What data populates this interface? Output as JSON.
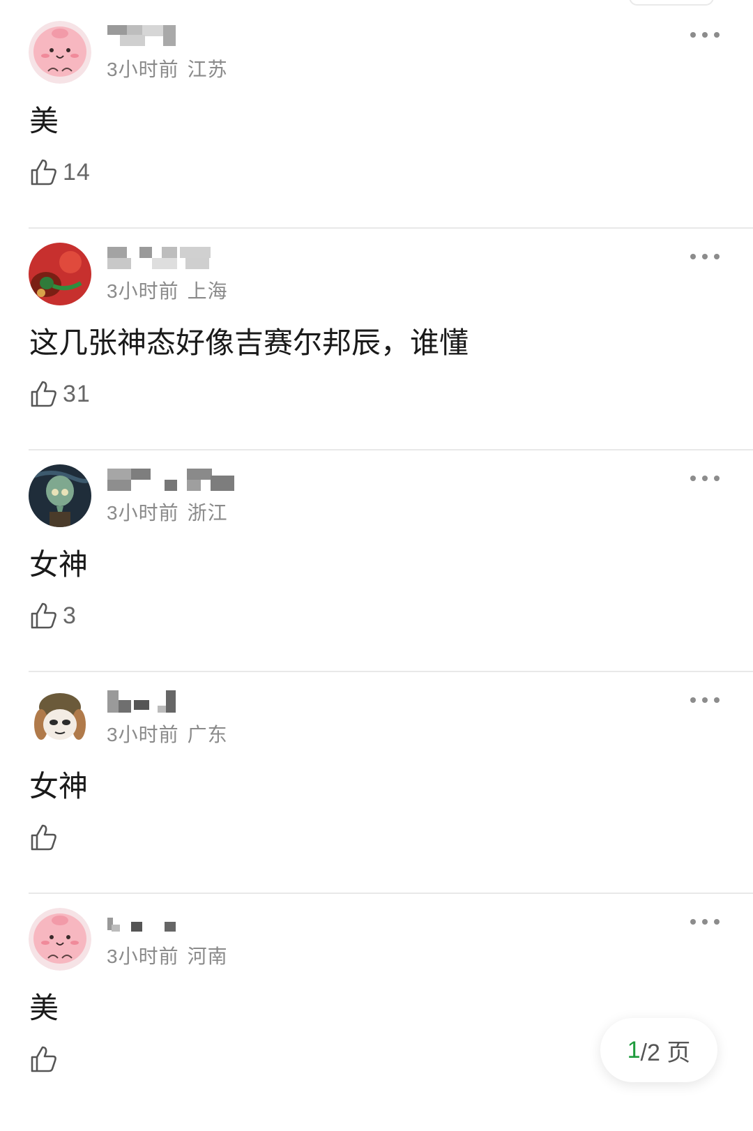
{
  "comments": [
    {
      "time": "3小时前",
      "location": "江苏",
      "text": "美",
      "likes": "14",
      "avatar": "pink-bun-cartoon"
    },
    {
      "time": "3小时前",
      "location": "上海",
      "text": "这几张神态好像吉赛尔邦辰，谁懂",
      "likes": "31",
      "avatar": "red-photo"
    },
    {
      "time": "3小时前",
      "location": "浙江",
      "text": "女神",
      "likes": "3",
      "avatar": "squidward-painting"
    },
    {
      "time": "3小时前",
      "location": "广东",
      "text": "女神",
      "likes": "",
      "avatar": "anime-dog-boy"
    },
    {
      "time": "3小时前",
      "location": "河南",
      "text": "美",
      "likes": "",
      "avatar": "pink-bun-cartoon"
    }
  ],
  "pager": {
    "current": "1",
    "rest": "/2 页"
  },
  "colors": {
    "accent": "#1e9b3c",
    "meta": "#8a8a8a",
    "divider": "#e8e8e8"
  }
}
